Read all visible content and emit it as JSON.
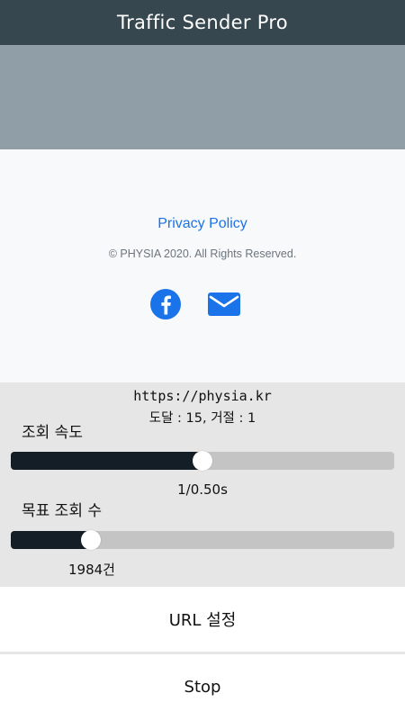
{
  "app": {
    "title": "Traffic Sender Pro"
  },
  "webview": {
    "privacy_link": "Privacy Policy",
    "copyright": "© PHYSIA 2020. All Rights Reserved.",
    "social_icons": [
      "facebook-icon",
      "mail-icon"
    ],
    "link_color": "#1a73e8",
    "hero_color": "#909ea7"
  },
  "controls": {
    "url": "https://physia.kr",
    "status": "도달 : 15, 거절 : 1",
    "speed": {
      "label": "조회 속도",
      "value_text": "1/0.50s",
      "level": 0.5
    },
    "target": {
      "label": "목표 조회 수",
      "value_text": "1984건",
      "level": 0.21
    }
  },
  "buttons": {
    "url_setting": "URL 설정",
    "stop": "Stop"
  },
  "colors": {
    "titlebar": "#37474f",
    "slider_fill": "#141e27",
    "slider_track": "#c4c4c4"
  }
}
